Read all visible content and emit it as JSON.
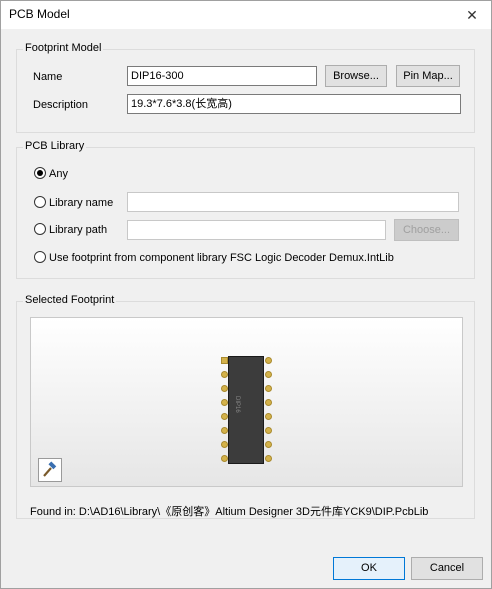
{
  "window": {
    "title": "PCB Model",
    "close_glyph": "✕"
  },
  "footprint_model": {
    "group_label": "Footprint Model",
    "name_label": "Name",
    "name_value": "DIP16-300",
    "browse_label": "Browse...",
    "pinmap_label": "Pin Map...",
    "description_label": "Description",
    "description_value": "19.3*7.6*3.8(长宽高)"
  },
  "pcb_library": {
    "group_label": "PCB Library",
    "options": {
      "any": "Any",
      "library_name": "Library name",
      "library_path": "Library path",
      "use_footprint": "Use footprint from component library FSC Logic Decoder Demux.IntLib"
    },
    "selected": "any",
    "choose_label": "Choose..."
  },
  "selected_footprint": {
    "group_label": "Selected Footprint",
    "chip_label": "DIP16",
    "found_in": "Found in:  D:\\AD16\\Library\\《原创客》Altium Designer 3D元件库YCK9\\DIP.PcbLib"
  },
  "footer": {
    "ok_label": "OK",
    "cancel_label": "Cancel"
  },
  "colors": {
    "pad": "#d4b24a",
    "chip": "#3c3c3c",
    "primary_border": "#0078d7"
  },
  "icons": {
    "tool": "hammer-icon",
    "close": "close-icon"
  }
}
